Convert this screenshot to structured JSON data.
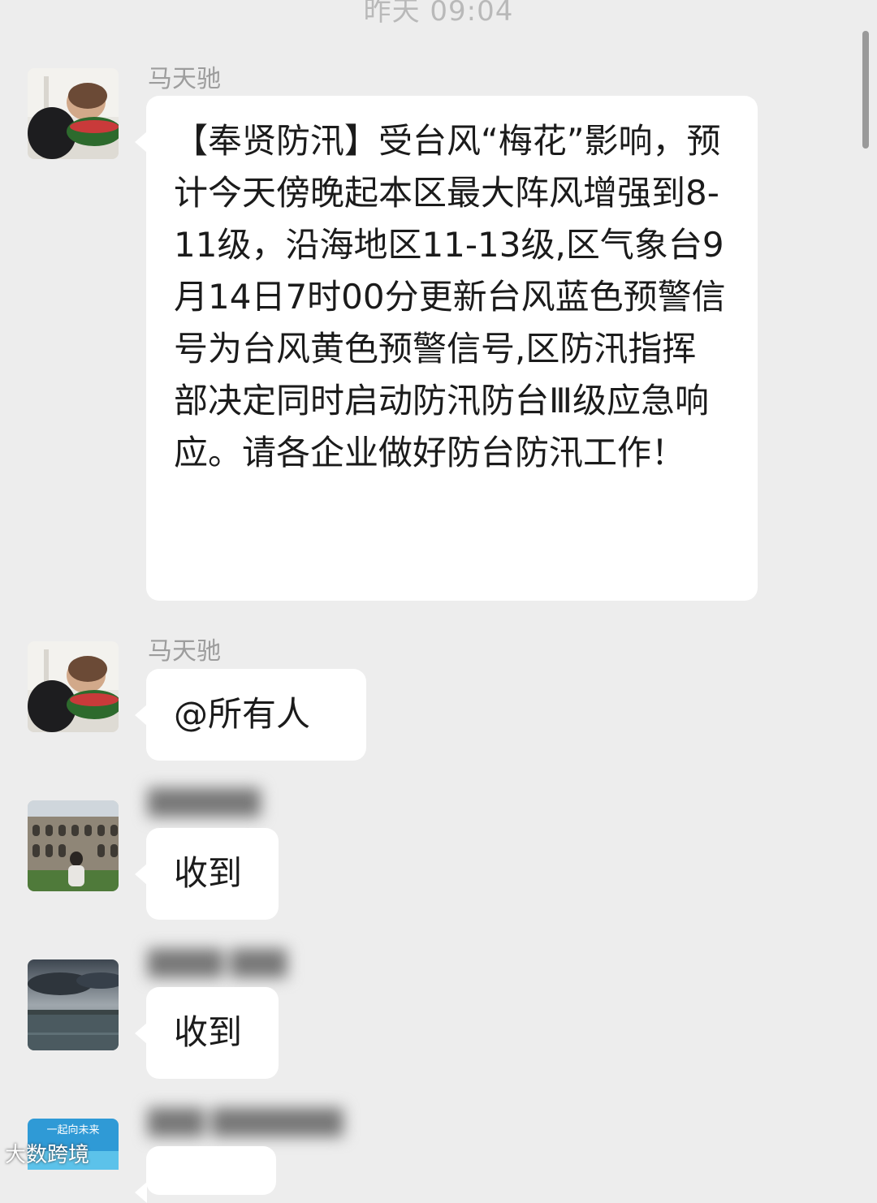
{
  "chat": {
    "timestamp": "昨天 09:04",
    "messages": [
      {
        "sender": "马天驰",
        "avatar": "boy-watermelon-avatar",
        "text": "【奉贤防汛】受台风“梅花”影响，预计今天傍晚起本区最大阵风增强到8-11级，沿海地区11-13级,区气象台9月14日7时00分更新台风蓝色预警信号为台风黄色预警信号,区防汛指挥部决定同时启动防汛防台Ⅲ级应急响应。请各企业做好防台防汛工作！"
      },
      {
        "sender": "马天驰",
        "avatar": "boy-watermelon-avatar",
        "text": "@所有人"
      },
      {
        "sender": "",
        "avatar": "colosseum-avatar",
        "text": "收到"
      },
      {
        "sender": "",
        "avatar": "sea-clouds-avatar",
        "text": "收到"
      },
      {
        "sender": "",
        "avatar": "blue-card-avatar",
        "avatar_text": "一起向未来",
        "text": ""
      }
    ]
  },
  "watermark": "大数跨境",
  "colors": {
    "background": "#ededed",
    "bubble": "#ffffff",
    "sender_name": "#9d9d9d",
    "timestamp": "#b9b9b9"
  }
}
